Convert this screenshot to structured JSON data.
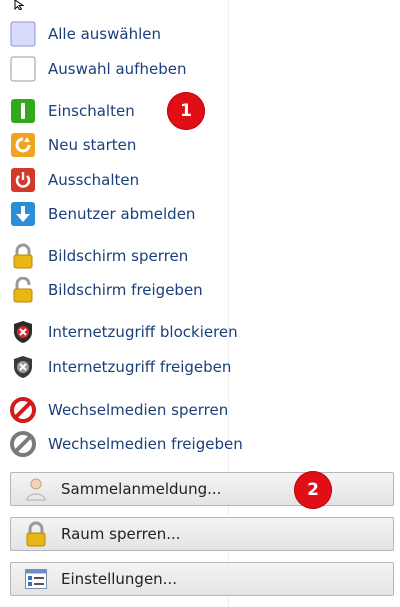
{
  "menu": {
    "select_all": "Alle auswählen",
    "deselect": "Auswahl aufheben",
    "power_on": "Einschalten",
    "restart": "Neu starten",
    "shutdown": "Ausschalten",
    "logoff": "Benutzer abmelden",
    "lock_screen": "Bildschirm sperren",
    "unlock_screen": "Bildschirm freigeben",
    "block_internet": "Internetzugriff blockieren",
    "allow_internet": "Internetzugriff freigeben",
    "lock_media": "Wechselmedien sperren",
    "unlock_media": "Wechselmedien freigeben"
  },
  "buttons": {
    "group_login": "Sammelanmeldung...",
    "lock_room": "Raum sperren...",
    "settings": "Einstellungen..."
  },
  "badges": {
    "one": "1",
    "two": "2"
  },
  "colors": {
    "link": "#1b3f7a",
    "badge": "#e10f15"
  }
}
